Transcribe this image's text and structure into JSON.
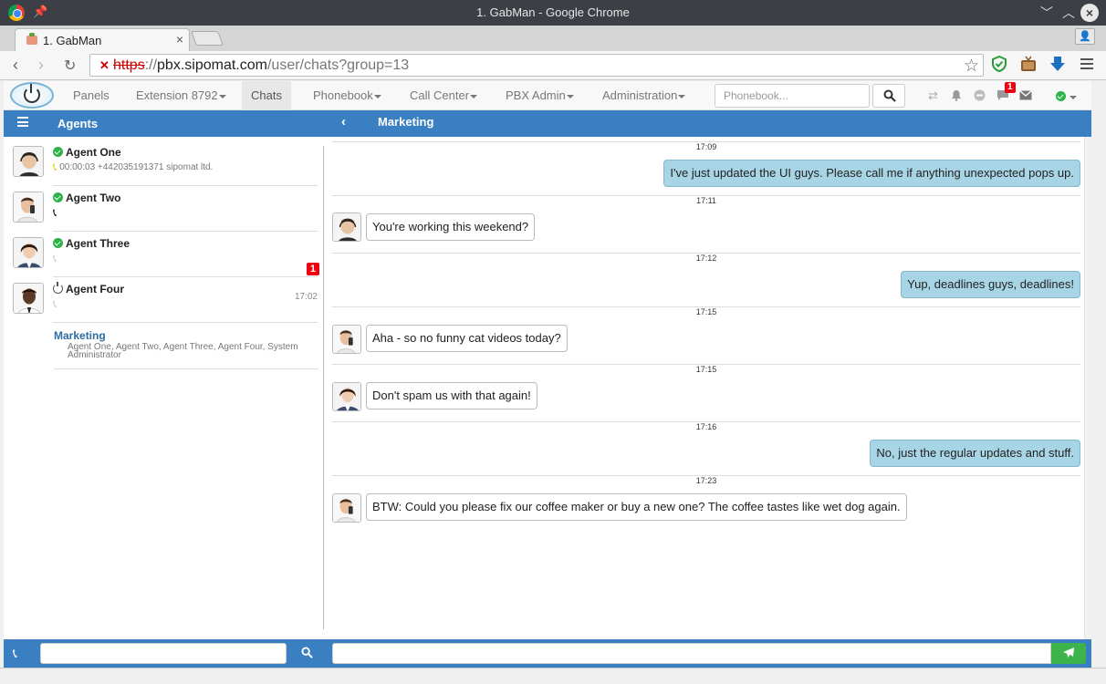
{
  "window": {
    "title": "1. GabMan - Google Chrome",
    "tab_title": "1. GabMan"
  },
  "address_bar": {
    "scheme": "https",
    "sep": "://",
    "host": "pbx.sipomat.com",
    "path": "/user/chats?group=13"
  },
  "navbar": {
    "items": [
      {
        "label": "Panels",
        "dropdown": false
      },
      {
        "label": "Extension 8792",
        "dropdown": true
      },
      {
        "label": "Chats",
        "dropdown": false,
        "active": true
      },
      {
        "label": "Phonebook",
        "dropdown": true
      },
      {
        "label": "Call Center",
        "dropdown": true
      },
      {
        "label": "PBX Admin",
        "dropdown": true
      },
      {
        "label": "Administration",
        "dropdown": true
      }
    ],
    "search_placeholder": "Phonebook...",
    "chat_badge": "1"
  },
  "agents_panel": {
    "title": "Agents",
    "agents": [
      {
        "name": "Agent One",
        "status": "online",
        "call_info": "00:00:03 +442035191371 sipomat ltd.",
        "phone_state": "ringing"
      },
      {
        "name": "Agent Two",
        "status": "online",
        "call_info": "",
        "phone_state": "available"
      },
      {
        "name": "Agent Three",
        "status": "online",
        "call_info": "",
        "phone_state": "idle",
        "unread": "1"
      },
      {
        "name": "Agent Four",
        "status": "offline",
        "call_info": "",
        "phone_state": "idle",
        "time": "17:02"
      }
    ],
    "group": {
      "name": "Marketing",
      "members": "Agent One, Agent Two, Agent Three, Agent Four, System Administrator"
    }
  },
  "chat": {
    "title": "Marketing",
    "messages": [
      {
        "time": "17:09",
        "direction": "out",
        "text": "I've just updated the UI guys. Please call me if anything unexpected pops up."
      },
      {
        "time": "17:11",
        "direction": "in",
        "sender": "Agent One",
        "text": "You're working this weekend?"
      },
      {
        "time": "17:12",
        "direction": "out",
        "text": "Yup, deadlines guys, deadlines!"
      },
      {
        "time": "17:15",
        "direction": "in",
        "sender": "Agent Two",
        "text": "Aha - so no funny cat videos today?"
      },
      {
        "time": "17:15",
        "direction": "in",
        "sender": "Agent Three",
        "text": "Don't spam us with that again!"
      },
      {
        "time": "17:16",
        "direction": "out",
        "text": "No, just the regular updates and stuff."
      },
      {
        "time": "17:23",
        "direction": "in",
        "sender": "Agent Two",
        "text": "BTW: Could you please fix our coffee maker or buy a new one? The coffee tastes like wet dog again."
      }
    ]
  },
  "bottom_bar": {
    "dial_value": "",
    "chat_value": ""
  },
  "colors": {
    "primary": "#3a7fc1",
    "outgoing_bubble": "#a8d5e5",
    "online": "#2cb34a",
    "send": "#3cb44b",
    "badge": "#e01111"
  }
}
